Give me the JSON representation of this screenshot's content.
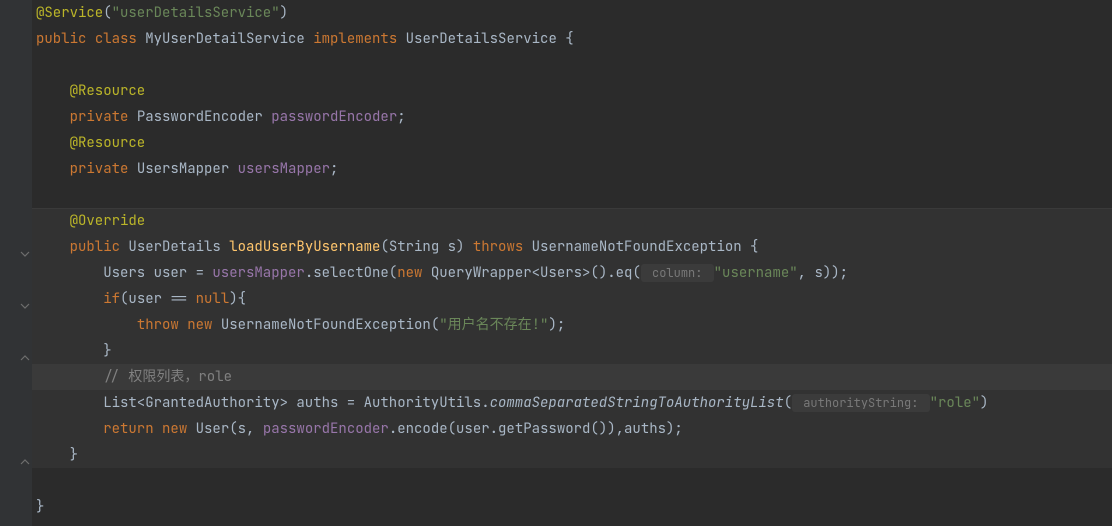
{
  "code": {
    "l1_anno": "@Service",
    "l1_str": "\"userDetailsService\"",
    "l2_public": "public",
    "l2_class": "class",
    "l2_name": "MyUserDetailService",
    "l2_impl": "implements",
    "l2_iface": "UserDetailsService {",
    "l4_anno": "@Resource",
    "l5_private": "private",
    "l5_type": "PasswordEncoder",
    "l5_field": "passwordEncoder",
    "l6_anno": "@Resource",
    "l7_private": "private",
    "l7_type": "UsersMapper",
    "l7_field": "usersMapper",
    "l9_anno": "@Override",
    "l10_public": "public",
    "l10_ret": "UserDetails",
    "l10_method": "loadUserByUsername",
    "l10_params": "(String s)",
    "l10_throws": "throws",
    "l10_exc": "UsernameNotFoundException {",
    "l11_decl": "Users user = ",
    "l11_field": "usersMapper",
    "l11_call": ".selectOne(",
    "l11_new": "new",
    "l11_ctor": " QueryWrapper<Users>().eq(",
    "l11_hint": " column: ",
    "l11_str": "\"username\"",
    "l11_tail": ", s));",
    "l12_if": "if",
    "l12_cond_a": "(user == ",
    "l12_null": "null",
    "l12_cond_b": "){",
    "l13_throw": "throw",
    "l13_new": "new",
    "l13_exc": " UsernameNotFoundException(",
    "l13_str": "\"用户名不存在!\"",
    "l13_tail": ");",
    "l14_close": "}",
    "l15_comment": "// 权限列表，role",
    "l16_decl": "List<GrantedAuthority> auths = AuthorityUtils.",
    "l16_static": "commaSeparatedStringToAuthorityList",
    "l16_open": "(",
    "l16_hint": " authorityString: ",
    "l16_str": "\"role\"",
    "l16_tail": ")",
    "l17_return": "return",
    "l17_new": "new",
    "l17_ctor": " User(s, ",
    "l17_field": "passwordEncoder",
    "l17_call": ".encode(user.getPassword()),auths);",
    "l18_close": "}",
    "l20_close": "}"
  }
}
